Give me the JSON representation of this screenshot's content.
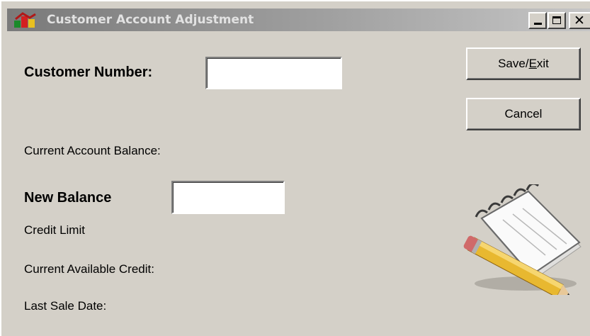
{
  "window": {
    "title": "Customer Account Adjustment",
    "controls": {
      "minimize_icon": "minimize-icon",
      "maximize_icon": "maximize-icon",
      "close_icon": "close-icon"
    }
  },
  "form": {
    "customer_number_label": "Customer Number:",
    "customer_number_value": "",
    "current_balance_label": "Current Account Balance:",
    "new_balance_label": "New Balance",
    "new_balance_value": "",
    "credit_limit_label": "Credit Limit",
    "available_credit_label": "Current Available Credit:",
    "last_sale_date_label": "Last Sale Date:"
  },
  "buttons": {
    "save_exit_pre": "Save/",
    "save_exit_mnemonic": "E",
    "save_exit_post": "xit",
    "cancel": "Cancel"
  },
  "icons": {
    "app": "app-logo-icon",
    "decoration": "notepad-pencil-icon"
  },
  "colors": {
    "face": "#d4d0c8",
    "title_inactive": "#7a7a7a",
    "title_text": "#e2e2e2"
  }
}
